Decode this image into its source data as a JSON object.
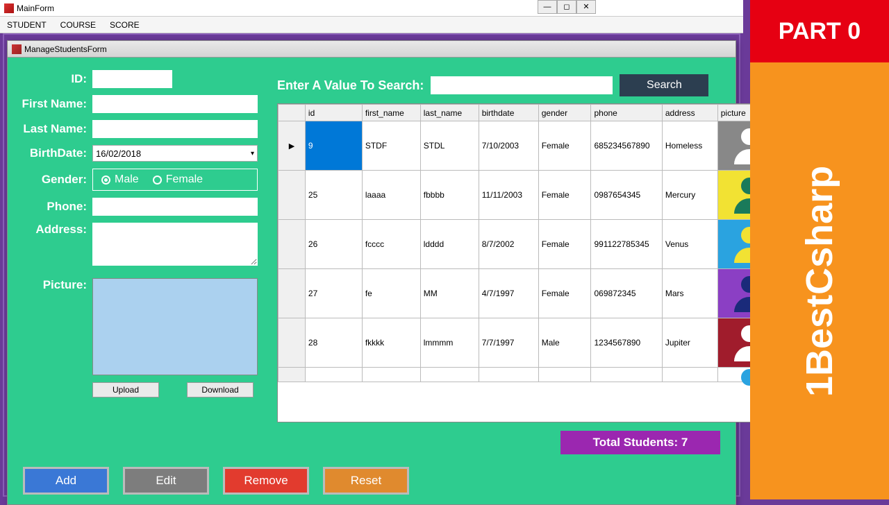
{
  "mainWindow": {
    "title": "MainForm"
  },
  "menu": {
    "student": "STUDENT",
    "course": "COURSE",
    "score": "SCORE"
  },
  "childWindow": {
    "title": "ManageStudentsForm"
  },
  "labels": {
    "id": "ID:",
    "firstName": "First Name:",
    "lastName": "Last Name:",
    "birthDate": "BirthDate:",
    "gender": "Gender:",
    "phone": "Phone:",
    "address": "Address:",
    "picture": "Picture:"
  },
  "form": {
    "birthDate": "16/02/2018"
  },
  "gender": {
    "male": "Male",
    "female": "Female"
  },
  "picBtns": {
    "upload": "Upload",
    "download": "Download"
  },
  "search": {
    "label": "Enter A Value To Search:",
    "button": "Search"
  },
  "grid": {
    "headers": [
      "id",
      "first_name",
      "last_name",
      "birthdate",
      "gender",
      "phone",
      "address",
      "picture"
    ],
    "rows": [
      {
        "id": "9",
        "first_name": "STDF",
        "last_name": "STDL",
        "birthdate": "7/10/2003",
        "gender": "Female",
        "phone": "685234567890",
        "address": "Homeless",
        "pic": {
          "bg": "#888",
          "fg": "#fff"
        }
      },
      {
        "id": "25",
        "first_name": "laaaa",
        "last_name": "fbbbb",
        "birthdate": "11/11/2003",
        "gender": "Female",
        "phone": "0987654345",
        "address": "Mercury",
        "pic": {
          "bg": "#f2e233",
          "fg": "#1a7a5a"
        }
      },
      {
        "id": "26",
        "first_name": "fcccc",
        "last_name": "ldddd",
        "birthdate": "8/7/2002",
        "gender": "Female",
        "phone": "991122785345",
        "address": "Venus",
        "pic": {
          "bg": "#2aa3e0",
          "fg": "#f2e233"
        }
      },
      {
        "id": "27",
        "first_name": "fe",
        "last_name": "MM",
        "birthdate": "4/7/1997",
        "gender": "Female",
        "phone": "069872345",
        "address": "Mars",
        "pic": {
          "bg": "#8b3fc4",
          "fg": "#1a2a7a"
        }
      },
      {
        "id": "28",
        "first_name": "fkkkk",
        "last_name": "lmmmm",
        "birthdate": "7/7/1997",
        "gender": "Male",
        "phone": "1234567890",
        "address": "Jupiter",
        "pic": {
          "bg": "#a01c2c",
          "fg": "#fff"
        }
      }
    ]
  },
  "total": {
    "label": "Total Students:",
    "value": "7"
  },
  "actions": {
    "add": "Add",
    "edit": "Edit",
    "remove": "Remove",
    "reset": "Reset"
  },
  "overlay": {
    "part": "PART 0",
    "brand": "1BestCsharp"
  }
}
